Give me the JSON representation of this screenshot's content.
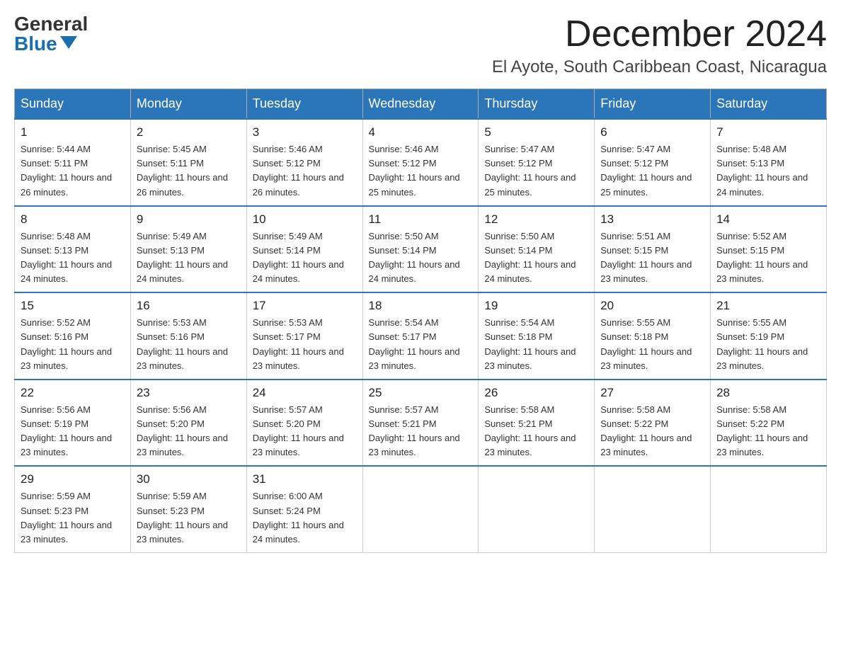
{
  "header": {
    "logo_general": "General",
    "logo_blue": "Blue",
    "month": "December 2024",
    "location": "El Ayote, South Caribbean Coast, Nicaragua"
  },
  "days_of_week": [
    "Sunday",
    "Monday",
    "Tuesday",
    "Wednesday",
    "Thursday",
    "Friday",
    "Saturday"
  ],
  "weeks": [
    [
      {
        "day": "1",
        "sunrise": "5:44 AM",
        "sunset": "5:11 PM",
        "daylight": "11 hours and 26 minutes."
      },
      {
        "day": "2",
        "sunrise": "5:45 AM",
        "sunset": "5:11 PM",
        "daylight": "11 hours and 26 minutes."
      },
      {
        "day": "3",
        "sunrise": "5:46 AM",
        "sunset": "5:12 PM",
        "daylight": "11 hours and 26 minutes."
      },
      {
        "day": "4",
        "sunrise": "5:46 AM",
        "sunset": "5:12 PM",
        "daylight": "11 hours and 25 minutes."
      },
      {
        "day": "5",
        "sunrise": "5:47 AM",
        "sunset": "5:12 PM",
        "daylight": "11 hours and 25 minutes."
      },
      {
        "day": "6",
        "sunrise": "5:47 AM",
        "sunset": "5:12 PM",
        "daylight": "11 hours and 25 minutes."
      },
      {
        "day": "7",
        "sunrise": "5:48 AM",
        "sunset": "5:13 PM",
        "daylight": "11 hours and 24 minutes."
      }
    ],
    [
      {
        "day": "8",
        "sunrise": "5:48 AM",
        "sunset": "5:13 PM",
        "daylight": "11 hours and 24 minutes."
      },
      {
        "day": "9",
        "sunrise": "5:49 AM",
        "sunset": "5:13 PM",
        "daylight": "11 hours and 24 minutes."
      },
      {
        "day": "10",
        "sunrise": "5:49 AM",
        "sunset": "5:14 PM",
        "daylight": "11 hours and 24 minutes."
      },
      {
        "day": "11",
        "sunrise": "5:50 AM",
        "sunset": "5:14 PM",
        "daylight": "11 hours and 24 minutes."
      },
      {
        "day": "12",
        "sunrise": "5:50 AM",
        "sunset": "5:14 PM",
        "daylight": "11 hours and 24 minutes."
      },
      {
        "day": "13",
        "sunrise": "5:51 AM",
        "sunset": "5:15 PM",
        "daylight": "11 hours and 23 minutes."
      },
      {
        "day": "14",
        "sunrise": "5:52 AM",
        "sunset": "5:15 PM",
        "daylight": "11 hours and 23 minutes."
      }
    ],
    [
      {
        "day": "15",
        "sunrise": "5:52 AM",
        "sunset": "5:16 PM",
        "daylight": "11 hours and 23 minutes."
      },
      {
        "day": "16",
        "sunrise": "5:53 AM",
        "sunset": "5:16 PM",
        "daylight": "11 hours and 23 minutes."
      },
      {
        "day": "17",
        "sunrise": "5:53 AM",
        "sunset": "5:17 PM",
        "daylight": "11 hours and 23 minutes."
      },
      {
        "day": "18",
        "sunrise": "5:54 AM",
        "sunset": "5:17 PM",
        "daylight": "11 hours and 23 minutes."
      },
      {
        "day": "19",
        "sunrise": "5:54 AM",
        "sunset": "5:18 PM",
        "daylight": "11 hours and 23 minutes."
      },
      {
        "day": "20",
        "sunrise": "5:55 AM",
        "sunset": "5:18 PM",
        "daylight": "11 hours and 23 minutes."
      },
      {
        "day": "21",
        "sunrise": "5:55 AM",
        "sunset": "5:19 PM",
        "daylight": "11 hours and 23 minutes."
      }
    ],
    [
      {
        "day": "22",
        "sunrise": "5:56 AM",
        "sunset": "5:19 PM",
        "daylight": "11 hours and 23 minutes."
      },
      {
        "day": "23",
        "sunrise": "5:56 AM",
        "sunset": "5:20 PM",
        "daylight": "11 hours and 23 minutes."
      },
      {
        "day": "24",
        "sunrise": "5:57 AM",
        "sunset": "5:20 PM",
        "daylight": "11 hours and 23 minutes."
      },
      {
        "day": "25",
        "sunrise": "5:57 AM",
        "sunset": "5:21 PM",
        "daylight": "11 hours and 23 minutes."
      },
      {
        "day": "26",
        "sunrise": "5:58 AM",
        "sunset": "5:21 PM",
        "daylight": "11 hours and 23 minutes."
      },
      {
        "day": "27",
        "sunrise": "5:58 AM",
        "sunset": "5:22 PM",
        "daylight": "11 hours and 23 minutes."
      },
      {
        "day": "28",
        "sunrise": "5:58 AM",
        "sunset": "5:22 PM",
        "daylight": "11 hours and 23 minutes."
      }
    ],
    [
      {
        "day": "29",
        "sunrise": "5:59 AM",
        "sunset": "5:23 PM",
        "daylight": "11 hours and 23 minutes."
      },
      {
        "day": "30",
        "sunrise": "5:59 AM",
        "sunset": "5:23 PM",
        "daylight": "11 hours and 23 minutes."
      },
      {
        "day": "31",
        "sunrise": "6:00 AM",
        "sunset": "5:24 PM",
        "daylight": "11 hours and 24 minutes."
      },
      null,
      null,
      null,
      null
    ]
  ]
}
